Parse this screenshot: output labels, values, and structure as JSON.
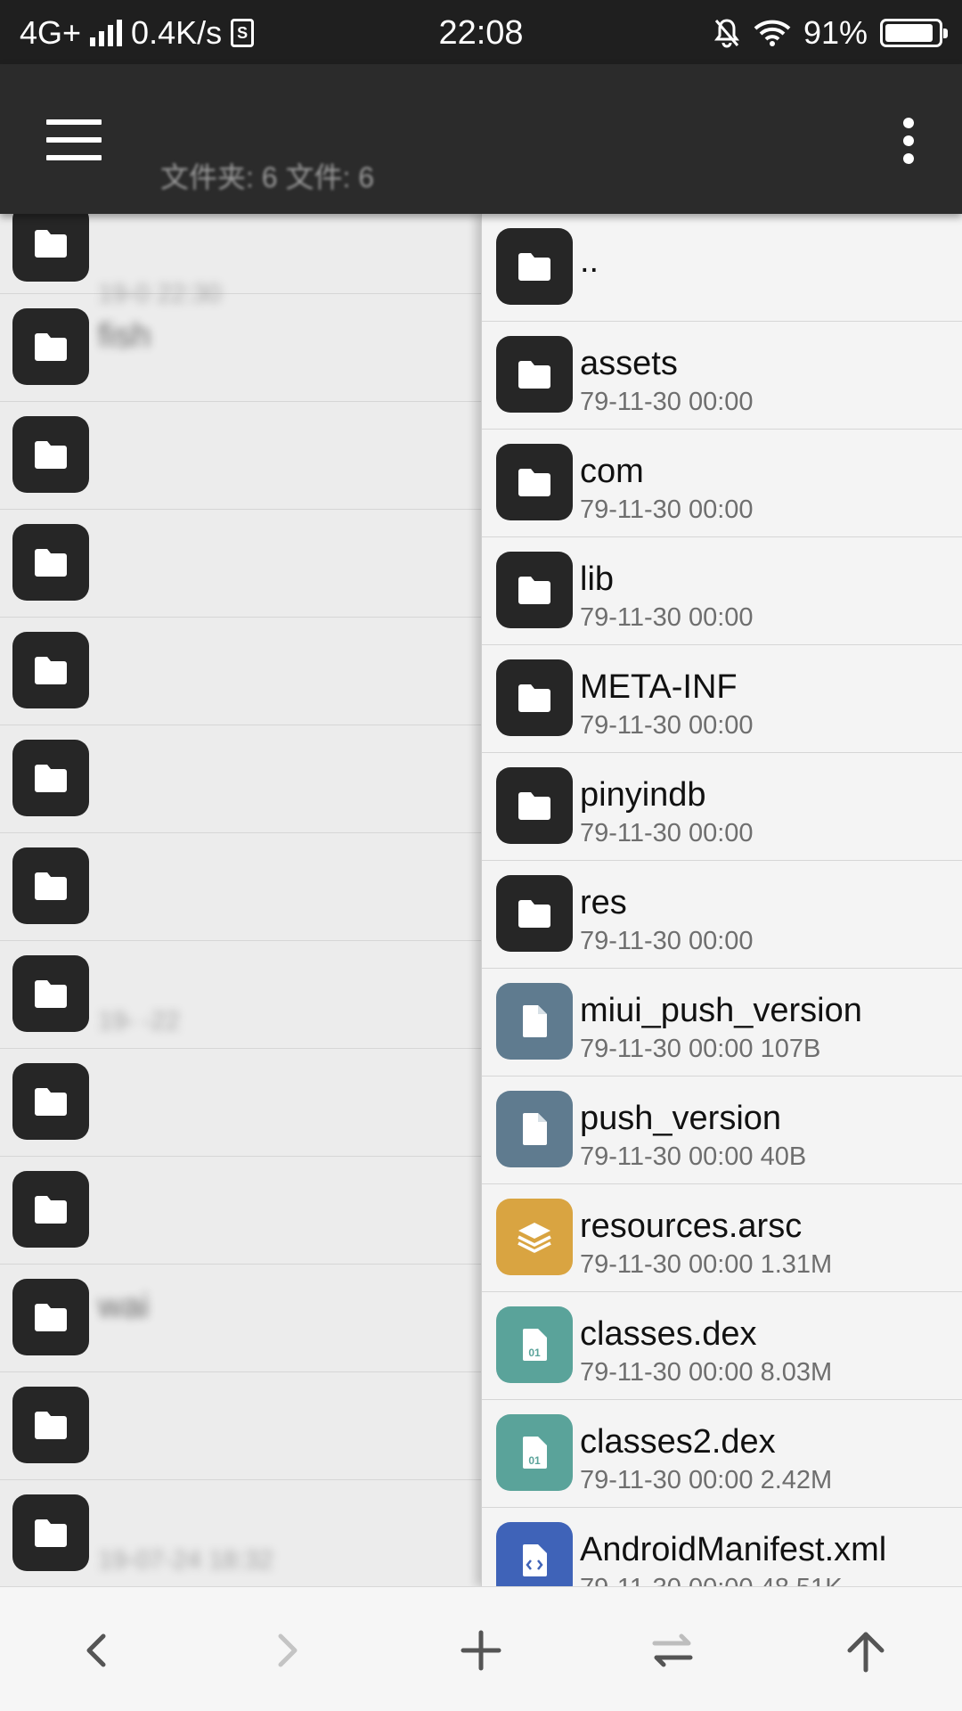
{
  "status_bar": {
    "network": "4G+",
    "speed": "0.4K/s",
    "time": "22:08",
    "battery": "91%",
    "battery_level": 0.91
  },
  "app_bar": {
    "title": "",
    "subtitle": "文件夹: 6  文件: 6"
  },
  "left_pane": {
    "items": [
      {
        "name": "",
        "meta": "19-0  22:30"
      },
      {
        "name": "fish",
        "meta": ""
      },
      {
        "name": "",
        "meta": ""
      },
      {
        "name": "",
        "meta": ""
      },
      {
        "name": "",
        "meta": ""
      },
      {
        "name": "",
        "meta": ""
      },
      {
        "name": "",
        "meta": ""
      },
      {
        "name": "",
        "meta": "19-  -22"
      },
      {
        "name": "",
        "meta": ""
      },
      {
        "name": "",
        "meta": ""
      },
      {
        "name": "wai",
        "meta": ""
      },
      {
        "name": "",
        "meta": ""
      },
      {
        "name": "",
        "meta": "19-07-24 18:32"
      }
    ]
  },
  "right_pane": {
    "items": [
      {
        "name": "..",
        "meta": "",
        "kind": "folder"
      },
      {
        "name": "assets",
        "meta": "79-11-30 00:00",
        "kind": "folder"
      },
      {
        "name": "com",
        "meta": "79-11-30 00:00",
        "kind": "folder"
      },
      {
        "name": "lib",
        "meta": "79-11-30 00:00",
        "kind": "folder"
      },
      {
        "name": "META-INF",
        "meta": "79-11-30 00:00",
        "kind": "folder"
      },
      {
        "name": "pinyindb",
        "meta": "79-11-30 00:00",
        "kind": "folder"
      },
      {
        "name": "res",
        "meta": "79-11-30 00:00",
        "kind": "folder"
      },
      {
        "name": "miui_push_version",
        "meta": "79-11-30 00:00  107B",
        "kind": "file"
      },
      {
        "name": "push_version",
        "meta": "79-11-30 00:00  40B",
        "kind": "file"
      },
      {
        "name": "resources.arsc",
        "meta": "79-11-30 00:00  1.31M",
        "kind": "arsc"
      },
      {
        "name": "classes.dex",
        "meta": "79-11-30 00:00  8.03M",
        "kind": "dex"
      },
      {
        "name": "classes2.dex",
        "meta": "79-11-30 00:00  2.42M",
        "kind": "dex"
      },
      {
        "name": "AndroidManifest.xml",
        "meta": "79-11-30 00:00  48.51K",
        "kind": "xml"
      }
    ]
  },
  "toolbar": {
    "buttons": [
      "back",
      "forward",
      "add",
      "swap-panes",
      "up-directory"
    ]
  },
  "colors": {
    "folder": "#262626",
    "file": "#5f7b8f",
    "arsc": "#d9a441",
    "dex": "#5aa39a",
    "xml": "#3f63b8",
    "appbar": "#2b2b2b",
    "statusbar": "#1f1f1f"
  },
  "icons": {
    "folder": "folder-icon",
    "file": "file-icon",
    "arsc": "layers-icon",
    "dex": "binary-file-icon",
    "xml": "code-file-icon"
  }
}
